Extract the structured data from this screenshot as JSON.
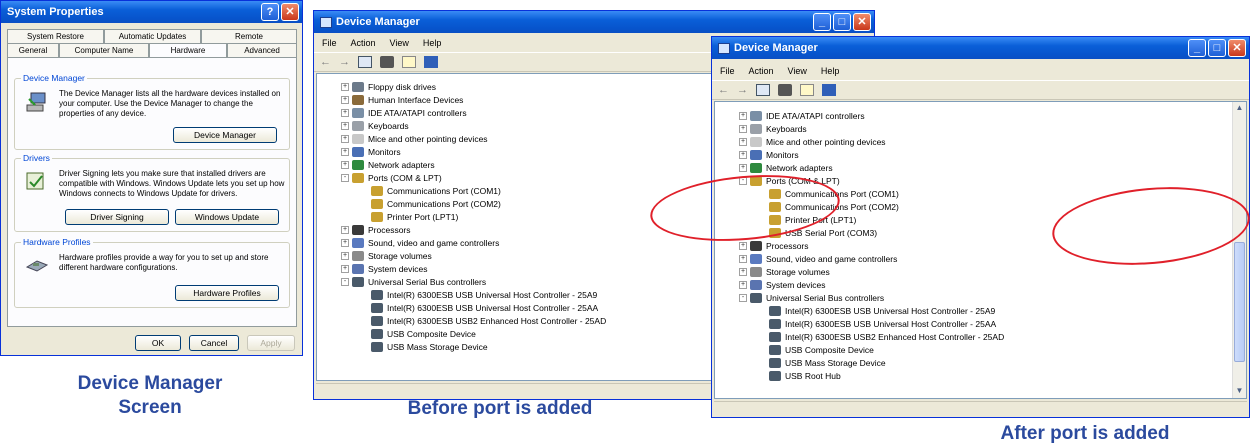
{
  "captions": {
    "left": "Device Manager\nScreen",
    "middle": "Before port is added",
    "right": "After port is added"
  },
  "sysprops": {
    "title": "System Properties",
    "tabs_top": [
      "System Restore",
      "Automatic Updates",
      "Remote"
    ],
    "tabs_bottom": [
      "General",
      "Computer Name",
      "Hardware",
      "Advanced"
    ],
    "groups": [
      {
        "title": "Device Manager",
        "text": "The Device Manager lists all the hardware devices installed on your computer. Use the Device Manager to change the properties of any device.",
        "buttons": [
          "Device Manager"
        ]
      },
      {
        "title": "Drivers",
        "text": "Driver Signing lets you make sure that installed drivers are compatible with Windows. Windows Update lets you set up how Windows connects to Windows Update for drivers.",
        "buttons": [
          "Driver Signing",
          "Windows Update"
        ]
      },
      {
        "title": "Hardware Profiles",
        "text": "Hardware profiles provide a way for you to set up and store different hardware configurations.",
        "buttons": [
          "Hardware Profiles"
        ]
      }
    ],
    "footer_buttons": [
      "OK",
      "Cancel",
      "Apply"
    ]
  },
  "dm_before": {
    "title": "Device Manager",
    "menu": [
      "File",
      "Action",
      "View",
      "Help"
    ],
    "rows": [
      {
        "exp": "+",
        "label": "Floppy disk drives",
        "icon": "floppy-icon"
      },
      {
        "exp": "+",
        "label": "Human Interface Devices",
        "icon": "hid-icon"
      },
      {
        "exp": "+",
        "label": "IDE ATA/ATAPI controllers",
        "icon": "ide-icon"
      },
      {
        "exp": "+",
        "label": "Keyboards",
        "icon": "keyboard-icon"
      },
      {
        "exp": "+",
        "label": "Mice and other pointing devices",
        "icon": "mouse-icon"
      },
      {
        "exp": "+",
        "label": "Monitors",
        "icon": "monitor-icon"
      },
      {
        "exp": "+",
        "label": "Network adapters",
        "icon": "network-icon"
      },
      {
        "exp": "-",
        "label": "Ports (COM & LPT)",
        "icon": "port-icon"
      },
      {
        "label": "Communications Port (COM1)",
        "icon": "port-icon",
        "child": true
      },
      {
        "label": "Communications Port (COM2)",
        "icon": "port-icon",
        "child": true
      },
      {
        "label": "Printer Port (LPT1)",
        "icon": "port-icon",
        "child": true
      },
      {
        "exp": "+",
        "label": "Processors",
        "icon": "processor-icon"
      },
      {
        "exp": "+",
        "label": "Sound, video and game controllers",
        "icon": "sound-icon"
      },
      {
        "exp": "+",
        "label": "Storage volumes",
        "icon": "storage-icon"
      },
      {
        "exp": "+",
        "label": "System devices",
        "icon": "system-icon"
      },
      {
        "exp": "-",
        "label": "Universal Serial Bus controllers",
        "icon": "usb-icon"
      },
      {
        "label": "Intel(R) 6300ESB USB Universal Host Controller - 25A9",
        "icon": "usb-icon",
        "child": true
      },
      {
        "label": "Intel(R) 6300ESB USB Universal Host Controller - 25AA",
        "icon": "usb-icon",
        "child": true
      },
      {
        "label": "Intel(R) 6300ESB USB2 Enhanced Host Controller - 25AD",
        "icon": "usb-icon",
        "child": true
      },
      {
        "label": "USB Composite Device",
        "icon": "usb-icon",
        "child": true
      },
      {
        "label": "USB Mass Storage Device",
        "icon": "usb-icon",
        "child": true
      }
    ]
  },
  "dm_after": {
    "title": "Device Manager",
    "menu": [
      "File",
      "Action",
      "View",
      "Help"
    ],
    "rows": [
      {
        "exp": "+",
        "label": "IDE ATA/ATAPI controllers",
        "icon": "ide-icon"
      },
      {
        "exp": "+",
        "label": "Keyboards",
        "icon": "keyboard-icon"
      },
      {
        "exp": "+",
        "label": "Mice and other pointing devices",
        "icon": "mouse-icon"
      },
      {
        "exp": "+",
        "label": "Monitors",
        "icon": "monitor-icon"
      },
      {
        "exp": "+",
        "label": "Network adapters",
        "icon": "network-icon"
      },
      {
        "exp": "-",
        "label": "Ports (COM & LPT)",
        "icon": "port-icon"
      },
      {
        "label": "Communications Port (COM1)",
        "icon": "port-icon",
        "child": true
      },
      {
        "label": "Communications Port (COM2)",
        "icon": "port-icon",
        "child": true
      },
      {
        "label": "Printer Port (LPT1)",
        "icon": "port-icon",
        "child": true
      },
      {
        "label": "USB Serial Port (COM3)",
        "icon": "port-icon",
        "child": true
      },
      {
        "exp": "+",
        "label": "Processors",
        "icon": "processor-icon"
      },
      {
        "exp": "+",
        "label": "Sound, video and game controllers",
        "icon": "sound-icon"
      },
      {
        "exp": "+",
        "label": "Storage volumes",
        "icon": "storage-icon"
      },
      {
        "exp": "+",
        "label": "System devices",
        "icon": "system-icon"
      },
      {
        "exp": "-",
        "label": "Universal Serial Bus controllers",
        "icon": "usb-icon"
      },
      {
        "label": "Intel(R) 6300ESB USB Universal Host Controller - 25A9",
        "icon": "usb-icon",
        "child": true
      },
      {
        "label": "Intel(R) 6300ESB USB Universal Host Controller - 25AA",
        "icon": "usb-icon",
        "child": true
      },
      {
        "label": "Intel(R) 6300ESB USB2 Enhanced Host Controller - 25AD",
        "icon": "usb-icon",
        "child": true
      },
      {
        "label": "USB Composite Device",
        "icon": "usb-icon",
        "child": true
      },
      {
        "label": "USB Mass Storage Device",
        "icon": "usb-icon",
        "child": true
      },
      {
        "label": "USB Root Hub",
        "icon": "usb-icon",
        "child": true
      }
    ]
  },
  "colors": {
    "caption": "#2b4a9e",
    "highlight": "#e0202a",
    "title_blue": "#0a5fd8"
  }
}
